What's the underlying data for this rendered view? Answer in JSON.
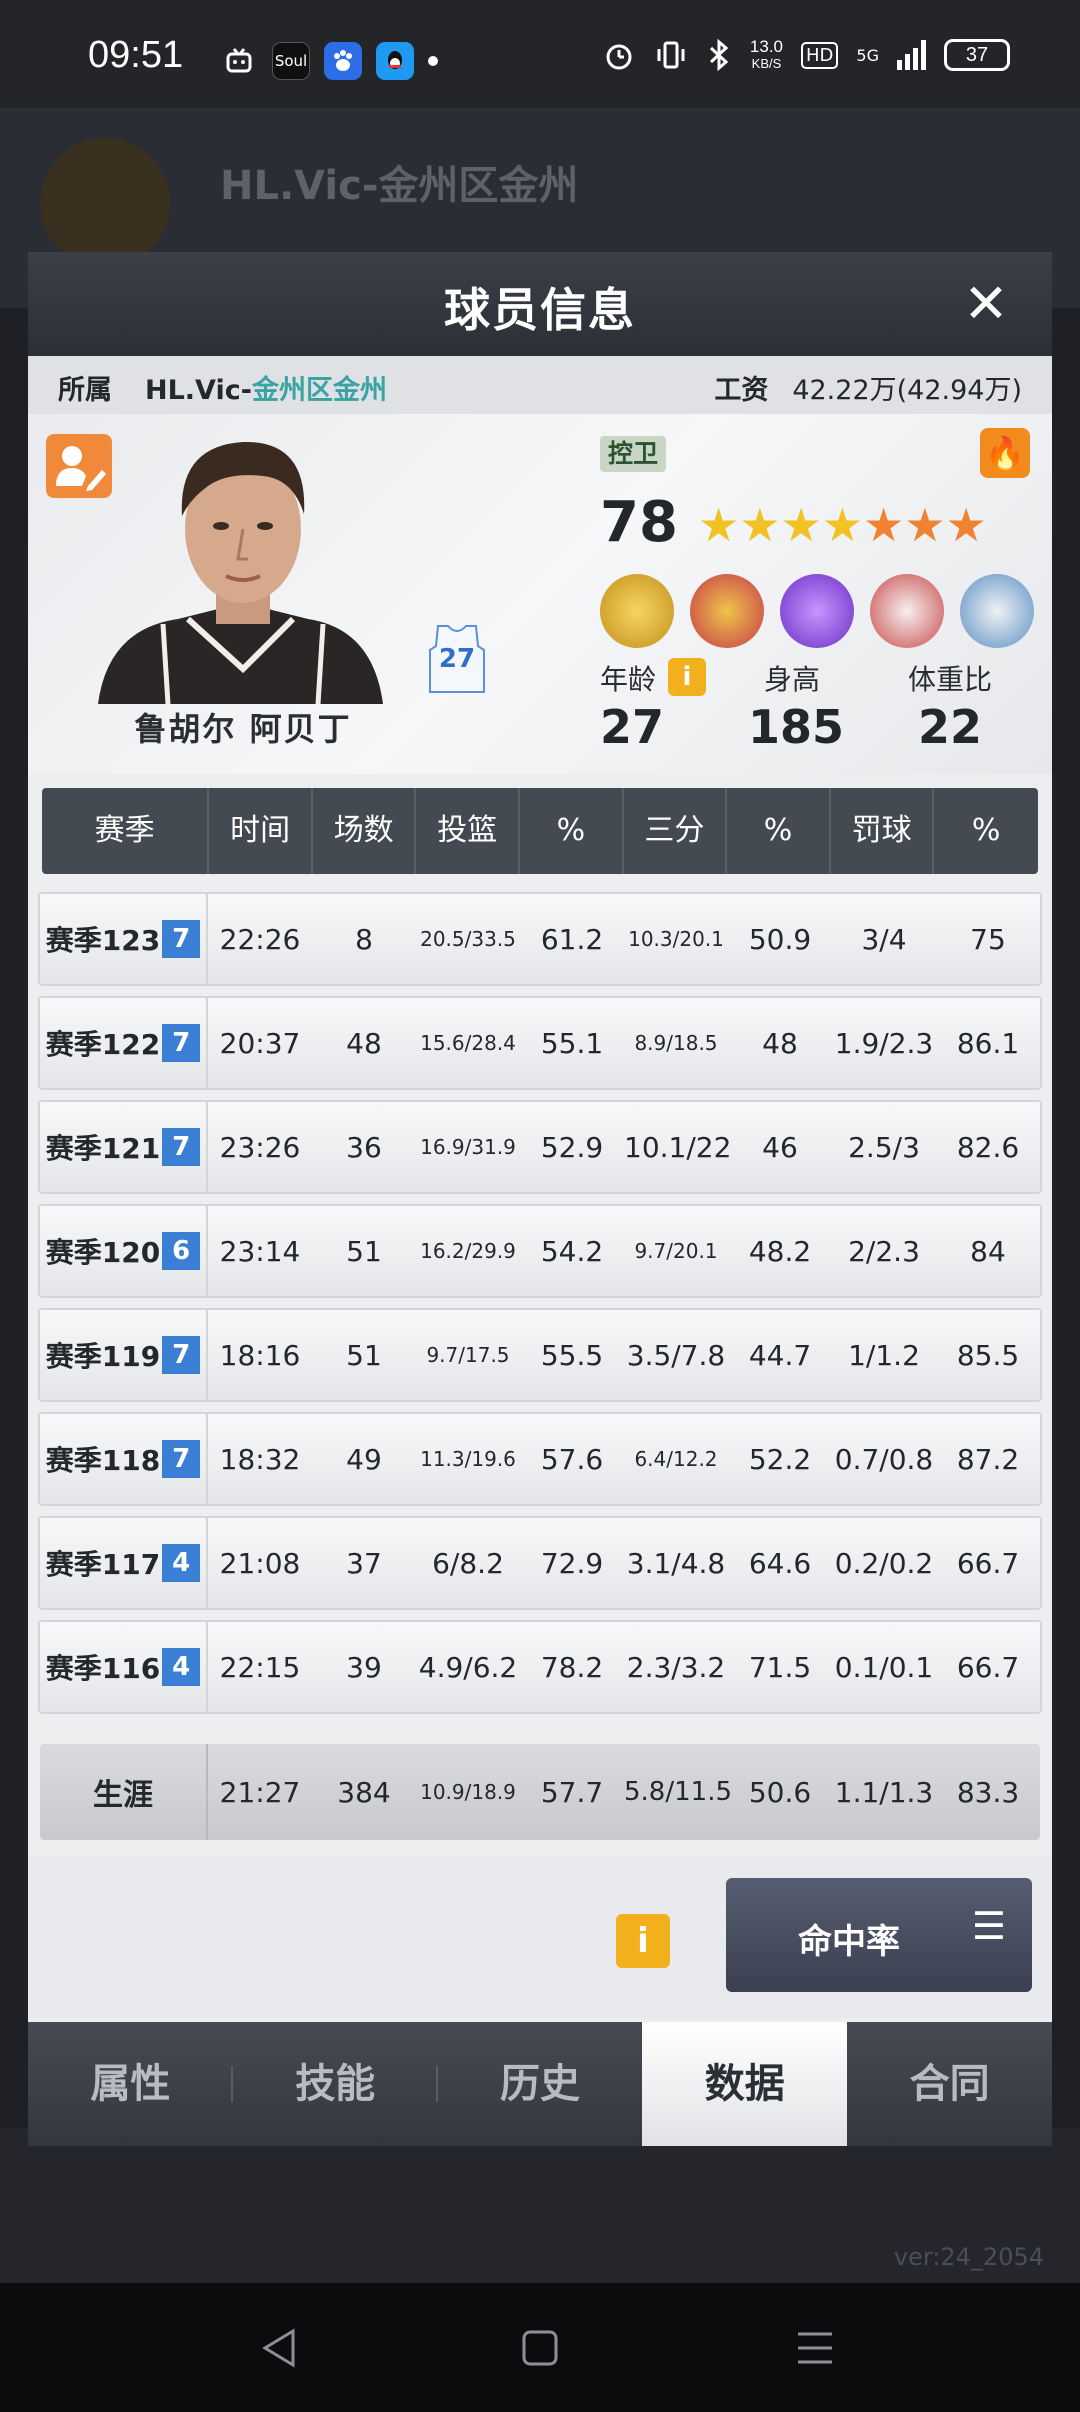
{
  "status_bar": {
    "time": "09:51",
    "apps": [
      {
        "icon": "tv-icon",
        "label": ""
      },
      {
        "icon": "soul-app-icon",
        "label": "Soul"
      },
      {
        "icon": "baidu-app-icon",
        "label": ""
      },
      {
        "icon": "qq-app-icon",
        "label": ""
      }
    ],
    "network_speed": "13.0",
    "network_unit": "KB/S",
    "hd": "HD",
    "signal": "5G",
    "battery": "37"
  },
  "background": {
    "team_title": "HL.Vic-金州区金州",
    "version": "ver:24_2054"
  },
  "modal": {
    "title": "球员信息",
    "team_label": "所属",
    "team_prefix": "HL.Vic-",
    "team_suffix": "金州区金州",
    "salary_label": "工资",
    "salary_value": "42.22万(42.94万)",
    "player_name": "鲁胡尔 阿贝丁",
    "jersey_number": "27",
    "position": "控卫",
    "overall": "78",
    "stars": {
      "gold": 4,
      "orange": 3
    },
    "skills": [
      "scorer-badge-icon",
      "defense-badge-icon",
      "speed-badge-icon",
      "wings-badge-icon",
      "rebound-badge-icon"
    ],
    "age_label": "年龄",
    "age_value": "27",
    "height_label": "身高",
    "height_value": "185",
    "bmi_label": "体重比",
    "bmi_value": "22"
  },
  "table": {
    "headers": [
      "赛季",
      "时间",
      "场数",
      "投篮",
      "%",
      "三分",
      "%",
      "罚球",
      "%"
    ],
    "rows": [
      {
        "season": "赛季123",
        "badge": "7",
        "time": "22:26",
        "games": "8",
        "fg": "20.5/33.5",
        "fg_pct": "61.2",
        "three": "10.3/20.1",
        "three_pct": "50.9",
        "ft": "3/4",
        "ft_pct": "75"
      },
      {
        "season": "赛季122",
        "badge": "7",
        "time": "20:37",
        "games": "48",
        "fg": "15.6/28.4",
        "fg_pct": "55.1",
        "three": "8.9/18.5",
        "three_pct": "48",
        "ft": "1.9/2.3",
        "ft_pct": "86.1"
      },
      {
        "season": "赛季121",
        "badge": "7",
        "time": "23:26",
        "games": "36",
        "fg": "16.9/31.9",
        "fg_pct": "52.9",
        "three": "10.1/22",
        "three_pct": "46",
        "ft": "2.5/3",
        "ft_pct": "82.6"
      },
      {
        "season": "赛季120",
        "badge": "6",
        "time": "23:14",
        "games": "51",
        "fg": "16.2/29.9",
        "fg_pct": "54.2",
        "three": "9.7/20.1",
        "three_pct": "48.2",
        "ft": "2/2.3",
        "ft_pct": "84"
      },
      {
        "season": "赛季119",
        "badge": "7",
        "time": "18:16",
        "games": "51",
        "fg": "9.7/17.5",
        "fg_pct": "55.5",
        "three": "3.5/7.8",
        "three_pct": "44.7",
        "ft": "1/1.2",
        "ft_pct": "85.5"
      },
      {
        "season": "赛季118",
        "badge": "7",
        "time": "18:32",
        "games": "49",
        "fg": "11.3/19.6",
        "fg_pct": "57.6",
        "three": "6.4/12.2",
        "three_pct": "52.2",
        "ft": "0.7/0.8",
        "ft_pct": "87.2"
      },
      {
        "season": "赛季117",
        "badge": "4",
        "time": "21:08",
        "games": "37",
        "fg": "6/8.2",
        "fg_pct": "72.9",
        "three": "3.1/4.8",
        "three_pct": "64.6",
        "ft": "0.2/0.2",
        "ft_pct": "66.7"
      },
      {
        "season": "赛季116",
        "badge": "4",
        "time": "22:15",
        "games": "39",
        "fg": "4.9/6.2",
        "fg_pct": "78.2",
        "three": "2.3/3.2",
        "three_pct": "71.5",
        "ft": "0.1/0.1",
        "ft_pct": "66.7"
      }
    ],
    "career": {
      "season": "生涯",
      "time": "21:27",
      "games": "384",
      "fg": "10.9/18.9",
      "fg_pct": "57.7",
      "three": "5.8/11.5",
      "three_pct": "50.6",
      "ft": "1.1/1.3",
      "ft_pct": "83.3"
    }
  },
  "footer": {
    "hit_rate_button": "命中率"
  },
  "tabs": [
    {
      "label": "属性",
      "active": false
    },
    {
      "label": "技能",
      "active": false
    },
    {
      "label": "历史",
      "active": false
    },
    {
      "label": "数据",
      "active": true
    },
    {
      "label": "合同",
      "active": false
    }
  ],
  "colors": {
    "header_dark": "#2b2f36",
    "season_badge": "#3b7fd4",
    "info_yellow": "#f2b01c",
    "fire_orange": "#f28a1c",
    "team_teal": "#3aa3a3"
  }
}
